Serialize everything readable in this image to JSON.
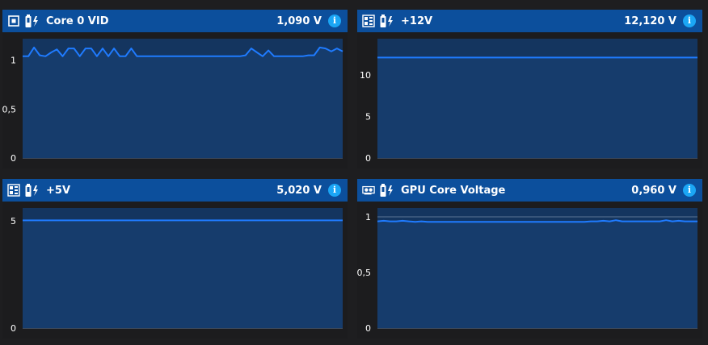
{
  "panels": [
    {
      "id": "core0vid",
      "label": "Core 0 VID",
      "value": "1,090 V",
      "icon": "cpu-icon",
      "chart_data": {
        "type": "area",
        "ylim": [
          0,
          1.22
        ],
        "yticks": [
          0,
          0.5,
          1
        ],
        "ytick_labels": [
          "0",
          "0,5",
          "1"
        ],
        "values": [
          1.04,
          1.04,
          1.13,
          1.05,
          1.04,
          1.08,
          1.11,
          1.04,
          1.12,
          1.12,
          1.04,
          1.12,
          1.12,
          1.04,
          1.12,
          1.04,
          1.12,
          1.04,
          1.04,
          1.12,
          1.04,
          1.04,
          1.04,
          1.04,
          1.04,
          1.04,
          1.04,
          1.04,
          1.04,
          1.04,
          1.04,
          1.04,
          1.04,
          1.04,
          1.04,
          1.04,
          1.04,
          1.04,
          1.04,
          1.05,
          1.12,
          1.08,
          1.04,
          1.1,
          1.04,
          1.04,
          1.04,
          1.04,
          1.04,
          1.04,
          1.05,
          1.05,
          1.13,
          1.12,
          1.09,
          1.12,
          1.09
        ]
      }
    },
    {
      "id": "plus12v",
      "label": "+12V",
      "value": "12,120 V",
      "icon": "motherboard-icon",
      "chart_data": {
        "type": "area",
        "ylim": [
          0,
          14.4
        ],
        "yticks": [
          0,
          5,
          10
        ],
        "ytick_labels": [
          "0",
          "5",
          "10"
        ],
        "values": [
          12.12,
          12.12,
          12.12,
          12.12,
          12.12,
          12.12,
          12.12,
          12.12,
          12.12,
          12.12,
          12.12,
          12.12
        ]
      }
    },
    {
      "id": "plus5v",
      "label": "+5V",
      "value": "5,020 V",
      "icon": "motherboard-icon",
      "chart_data": {
        "type": "area",
        "ylim": [
          0,
          5.6
        ],
        "yticks": [
          0,
          5
        ],
        "ytick_labels": [
          "0",
          "5"
        ],
        "values": [
          5.02,
          5.02,
          5.02,
          5.02,
          5.02,
          5.02,
          5.02,
          5.02,
          5.02,
          5.02,
          5.02,
          5.02
        ]
      }
    },
    {
      "id": "gpucorevoltage",
      "label": "GPU Core Voltage",
      "value": "0,960 V",
      "icon": "gpu-icon",
      "chart_data": {
        "type": "area",
        "ylim": [
          0,
          1.08
        ],
        "yticks": [
          0,
          0.5,
          1
        ],
        "ytick_labels": [
          "0",
          "0,5",
          "1"
        ],
        "values": [
          0.96,
          0.965,
          0.96,
          0.96,
          0.965,
          0.96,
          0.955,
          0.96,
          0.955,
          0.955,
          0.955,
          0.955,
          0.955,
          0.955,
          0.955,
          0.955,
          0.955,
          0.955,
          0.955,
          0.955,
          0.955,
          0.955,
          0.955,
          0.955,
          0.955,
          0.955,
          0.955,
          0.955,
          0.955,
          0.955,
          0.955,
          0.955,
          0.955,
          0.955,
          0.96,
          0.96,
          0.965,
          0.96,
          0.97,
          0.96,
          0.96,
          0.96,
          0.96,
          0.96,
          0.96,
          0.96,
          0.97,
          0.96,
          0.965,
          0.96,
          0.96,
          0.96
        ]
      }
    }
  ],
  "colors": {
    "header": "#0c4f9c",
    "plot_fill": "#14355f",
    "line": "#1f7bff",
    "grid": "#5b7596",
    "info": "#1ba6f5"
  }
}
